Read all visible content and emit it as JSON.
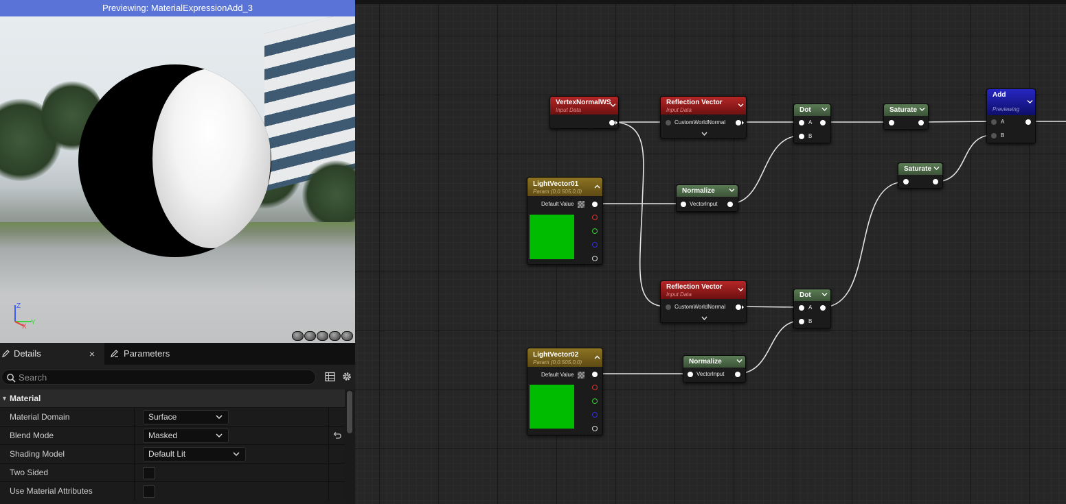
{
  "preview": {
    "title": "Previewing: MaterialExpressionAdd_3"
  },
  "tabs": {
    "details": "Details",
    "parameters": "Parameters",
    "close": "×"
  },
  "search": {
    "placeholder": "Search"
  },
  "material": {
    "section": "Material",
    "rows": [
      {
        "label": "Material Domain",
        "value": "Surface"
      },
      {
        "label": "Blend Mode",
        "value": "Masked"
      },
      {
        "label": "Shading Model",
        "value": "Default Lit"
      },
      {
        "label": "Two Sided",
        "checked": false
      },
      {
        "label": "Use Material Attributes",
        "checked": false
      }
    ]
  },
  "graph": {
    "nodes": {
      "vertex_normal": {
        "title": "VertexNormalWS",
        "subtitle": "Input Data"
      },
      "reflection1": {
        "title": "Reflection Vector",
        "subtitle": "Input Data",
        "pin": "CustomWorldNormal"
      },
      "reflection2": {
        "title": "Reflection Vector",
        "subtitle": "Input Data",
        "pin": "CustomWorldNormal"
      },
      "dot1": {
        "title": "Dot",
        "pin_a": "A",
        "pin_b": "B"
      },
      "dot2": {
        "title": "Dot",
        "pin_a": "A",
        "pin_b": "B"
      },
      "saturate1": {
        "title": "Saturate"
      },
      "saturate2": {
        "title": "Saturate"
      },
      "add": {
        "title": "Add",
        "subtitle": "Previewing",
        "pin_a": "A",
        "pin_b": "B"
      },
      "light1": {
        "title": "LightVector01",
        "subtitle": "Param (0,0.505,0,0)",
        "pin": "Default Value",
        "color": "#00bc00"
      },
      "light2": {
        "title": "LightVector02",
        "subtitle": "Param (0,0.505,0,0)",
        "pin": "Default Value",
        "color": "#00bc00"
      },
      "normalize1": {
        "title": "Normalize",
        "pin": "VectorInput"
      },
      "normalize2": {
        "title": "Normalize",
        "pin": "VectorInput"
      }
    }
  },
  "colors": {
    "title_bar": "#5a73d6",
    "input_data_header": "#b52626",
    "param_header": "#8c7422",
    "math_header": "#5b7c55",
    "add_header": "#2626c2"
  }
}
